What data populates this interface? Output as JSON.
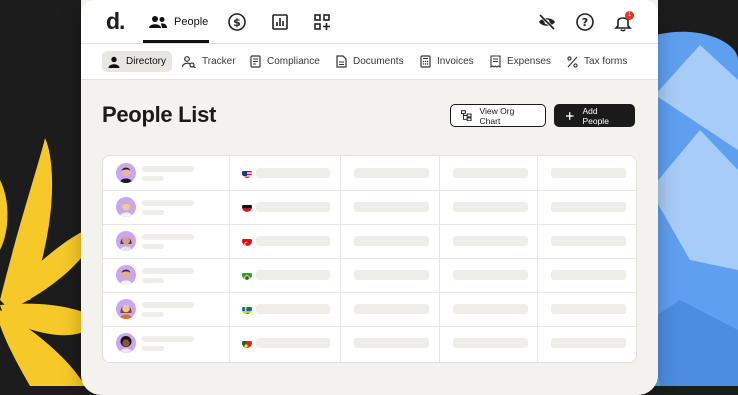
{
  "app": {
    "logo": "d.",
    "primary_nav": {
      "active_label": "People",
      "icons": [
        "people-icon",
        "dollar-circle-icon",
        "bar-chart-icon",
        "apps-grid-icon"
      ]
    },
    "utility_icons": [
      "eye-off-icon",
      "help-circle-icon",
      "bell-icon"
    ],
    "notification_count": "1"
  },
  "subnav": {
    "items": [
      {
        "label": "Directory",
        "icon": "person-icon",
        "active": true
      },
      {
        "label": "Tracker",
        "icon": "person-search-icon"
      },
      {
        "label": "Compliance",
        "icon": "document-check-icon"
      },
      {
        "label": "Documents",
        "icon": "document-icon"
      },
      {
        "label": "Invoices",
        "icon": "calculator-icon"
      },
      {
        "label": "Expenses",
        "icon": "receipt-icon"
      },
      {
        "label": "Tax forms",
        "icon": "percent-icon"
      }
    ]
  },
  "page": {
    "title": "People List",
    "buttons": {
      "org_chart": "View Org Chart",
      "add_people": "Add People"
    }
  },
  "table": {
    "rows": [
      {
        "flag": "us-flag-icon"
      },
      {
        "flag": "malawi-flag-icon"
      },
      {
        "flag": "turkey-flag-icon"
      },
      {
        "flag": "brazil-flag-icon"
      },
      {
        "flag": "sweden-flag-icon"
      },
      {
        "flag": "portugal-flag-icon"
      }
    ]
  },
  "colors": {
    "accent_dark": "#1a1a1a",
    "notification": "#e0352b",
    "background_yellow": "#f7c928",
    "background_blue": "#5f9ff0"
  }
}
